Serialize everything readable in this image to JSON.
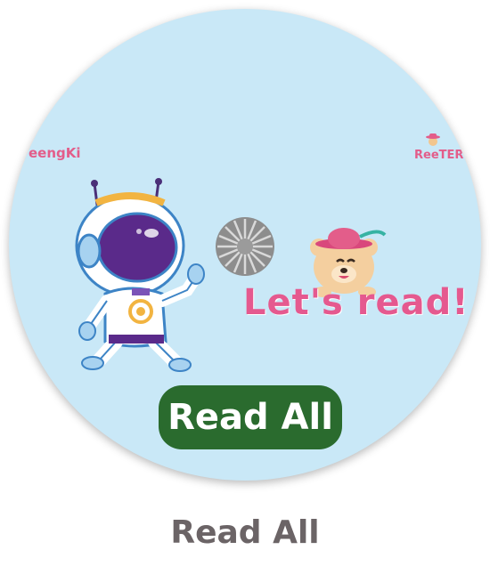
{
  "card": {
    "brand_left": "eengKi",
    "brand_right": "ReeTER",
    "heading": "Let's read!",
    "button_label": "Read All"
  },
  "caption": "Read All",
  "colors": {
    "card_background": "#c9e8f7",
    "heading_pink": "#e5598f",
    "button_green": "#2a6b2e",
    "caption_gray": "#6b6466"
  },
  "icons": {
    "astronaut": "astronaut-illustration",
    "loading": "loading-spinner-icon",
    "bear": "bear-with-hat-illustration"
  }
}
